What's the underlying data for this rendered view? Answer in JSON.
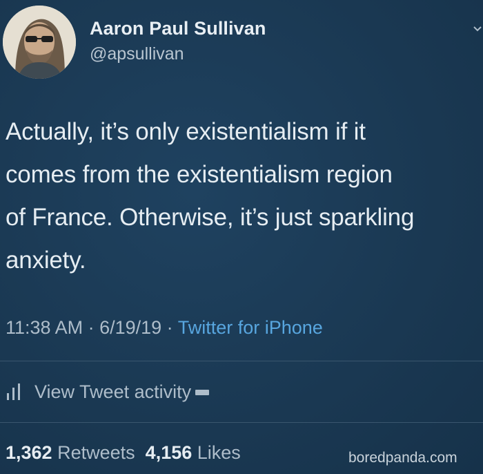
{
  "author": {
    "name": "Aaron Paul Sullivan",
    "handle": "@apsullivan"
  },
  "tweet": {
    "text": "Actually, it’s only existentialism if it\ncomes from the existentialism region\nof France. Otherwise, it’s just sparkling\nanxiety."
  },
  "meta": {
    "time": "11:38 AM",
    "separator": " · ",
    "date": "6/19/19",
    "source": "Twitter for iPhone"
  },
  "activity": {
    "label": "View Tweet activity",
    "icon": "bar-chart-icon"
  },
  "stats": {
    "retweets_count": "1,362",
    "retweets_label": "Retweets",
    "likes_count": "4,156",
    "likes_label": "Likes"
  },
  "watermark": "boredpanda.com",
  "colors": {
    "background": "#1b3a55",
    "link": "#58a6df",
    "primary_text": "#e6edf2",
    "secondary_text": "#aebdca"
  }
}
